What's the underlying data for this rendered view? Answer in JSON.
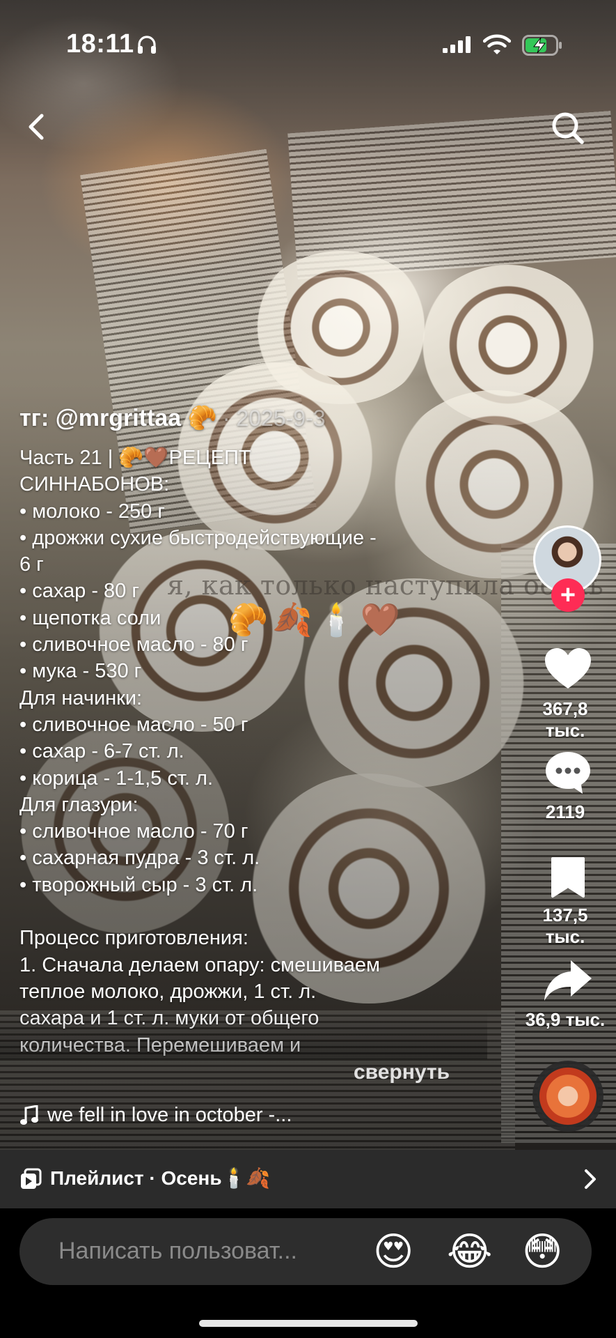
{
  "status_bar": {
    "time": "18:11",
    "icons": [
      "headphones-icon",
      "signal-icon",
      "wifi-icon",
      "battery-charging-icon"
    ],
    "battery_color": "#34c759"
  },
  "nav": {
    "back_icon": "chevron-left-icon",
    "search_icon": "search-icon"
  },
  "video": {
    "caption": "я, как только наступила осень",
    "caption_emoji": "🥐🍂🕯️🤎"
  },
  "post": {
    "author": "тг: @mrgrittaa 🥐",
    "date": "· 2025-9-3",
    "description": "Часть 21 | 🥐🤎РЕЦЕПТ\nСИННАБОНОВ:\n• молоко - 250 г\n• дрожжи сухие быстродействующие -\n6 г\n• сахар - 80 г\n• щепотка соли\n• сливочное масло - 80 г\n• мука - 530 г\nДля начинки:\n• сливочное масло - 50 г\n• сахар - 6-7 ст. л.\n• корица - 1-1,5 ст. л.\nДля глазури:\n• сливочное масло - 70 г\n• сахарная пудра - 3 ст. л.\n• творожный сыр - 3 ст. л.\n\nПроцесс приготовления:\n1. Сначала делаем опару: смешиваем\nтеплое молоко, дрожжи, 1 ст. л.\nсахара и 1 ст. л. муки от общего\nколичества. Перемешиваем и",
    "collapse_label": "свернуть"
  },
  "music": {
    "icon": "music-note-icon",
    "title": "we fell in love in october -..."
  },
  "actions": {
    "follow_label": "+",
    "likes": "367,8 тыс.",
    "comments": "2119",
    "bookmarks": "137,5 тыс.",
    "shares": "36,9 тыс."
  },
  "playlist": {
    "icon": "playlist-icon",
    "label": "Плейлист · Осень🕯️🍂"
  },
  "comment_bar": {
    "placeholder": "Написать пользоват...",
    "emojis": [
      "😍",
      "😂",
      "😳"
    ]
  },
  "colors": {
    "accent": "#fe2c55",
    "playlist_bg": "#2b2b2b",
    "input_bg": "#2d2d2d"
  }
}
